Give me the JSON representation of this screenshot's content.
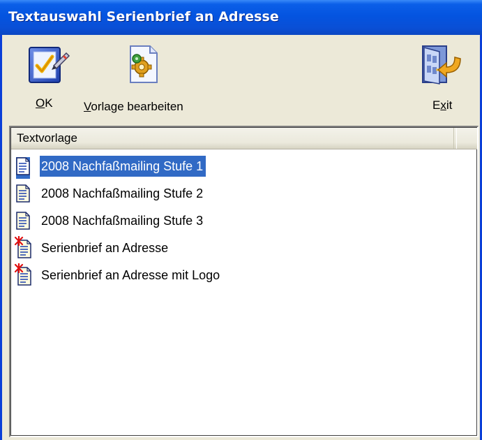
{
  "window": {
    "title": "Textauswahl Serienbrief an Adresse"
  },
  "toolbar": {
    "ok": {
      "prefix": "",
      "mnemonic": "O",
      "rest": "K",
      "icon": "checklist-pen-icon"
    },
    "edit_template": {
      "prefix": "",
      "mnemonic": "V",
      "rest": "orlage bearbeiten",
      "icon": "document-gear-icon"
    },
    "exit": {
      "prefix": "E",
      "mnemonic": "x",
      "rest": "it",
      "icon": "exit-door-icon"
    }
  },
  "list": {
    "column_header": "Textvorlage",
    "items": [
      {
        "label": "2008 Nachfaßmailing Stufe 1",
        "icon": "document-icon",
        "selected": true
      },
      {
        "label": "2008 Nachfaßmailing Stufe 2",
        "icon": "document-icon",
        "selected": false
      },
      {
        "label": "2008 Nachfaßmailing Stufe 3",
        "icon": "document-icon",
        "selected": false
      },
      {
        "label": "Serienbrief an Adresse",
        "icon": "serial-letter-document-icon",
        "selected": false
      },
      {
        "label": "Serienbrief an Adresse mit Logo",
        "icon": "serial-letter-document-icon",
        "selected": false
      }
    ]
  },
  "colors": {
    "titlebar": "#0454e0",
    "selection": "#316ac5",
    "window_bg": "#ece9d8"
  }
}
